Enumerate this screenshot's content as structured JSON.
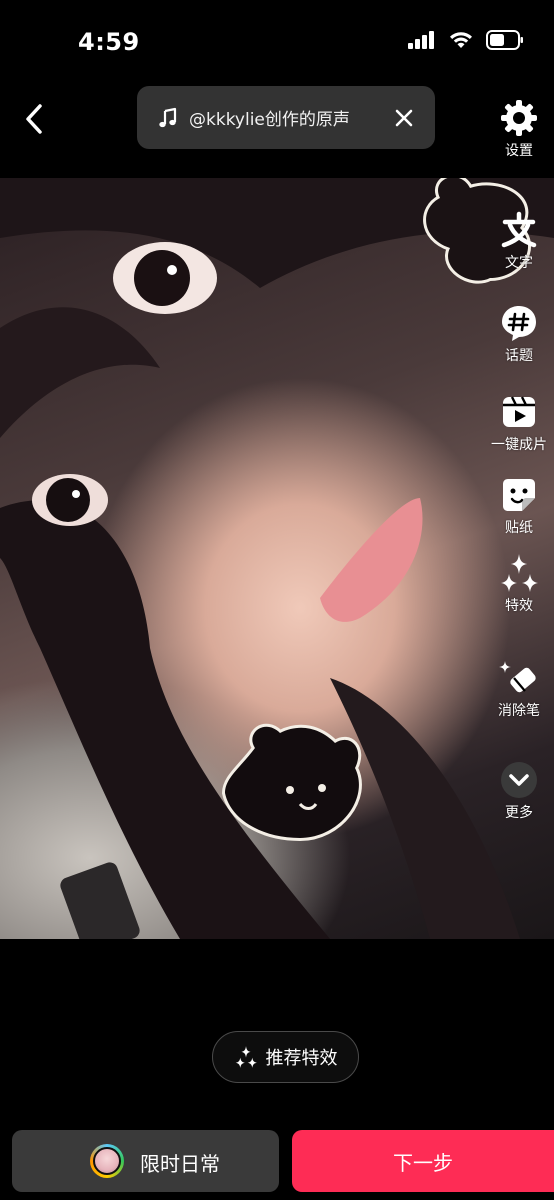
{
  "status_bar": {
    "time": "4:59"
  },
  "header": {
    "music_title": "@kkkylie创作的原声"
  },
  "toolbar": {
    "items": [
      {
        "label": "设置",
        "icon": "gear-icon"
      },
      {
        "label": "文字",
        "icon": "text-icon"
      },
      {
        "label": "话题",
        "icon": "hashtag-icon"
      },
      {
        "label": "一键成片",
        "icon": "one-click-video-icon"
      },
      {
        "label": "贴纸",
        "icon": "sticker-icon"
      },
      {
        "label": "特效",
        "icon": "sparkles-icon"
      },
      {
        "label": "消除笔",
        "icon": "eraser-icon"
      },
      {
        "label": "更多",
        "icon": "chevron-down-icon"
      }
    ]
  },
  "recommend_effect_label": "推荐特效",
  "bottom": {
    "daily_label": "限时日常",
    "next_label": "下一步"
  },
  "colors": {
    "primary": "#fe2c55",
    "pill_bg": "#333333",
    "secondary_btn_bg": "#3a3a3a"
  }
}
